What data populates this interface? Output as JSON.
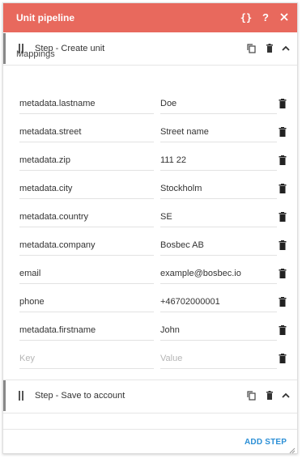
{
  "header": {
    "title": "Unit pipeline",
    "icons": [
      "code-icon",
      "help-icon",
      "close-icon"
    ],
    "color": "#e8695d"
  },
  "steps": [
    {
      "title": "Step - Create unit",
      "mappings_label": "Mappings",
      "mappings": [
        {
          "key": "metadata.lastname",
          "value": "Doe"
        },
        {
          "key": "metadata.street",
          "value": "Street name"
        },
        {
          "key": "metadata.zip",
          "value": "111 22"
        },
        {
          "key": "metadata.city",
          "value": "Stockholm"
        },
        {
          "key": "metadata.country",
          "value": "SE"
        },
        {
          "key": "metadata.company",
          "value": "Bosbec AB"
        },
        {
          "key": "email",
          "value": "example@bosbec.io"
        },
        {
          "key": "phone",
          "value": "+46702000001"
        },
        {
          "key": "metadata.firstname",
          "value": "John"
        }
      ],
      "new_mapping": {
        "key_placeholder": "Key",
        "value_placeholder": "Value"
      }
    },
    {
      "title": "Step - Save to account"
    }
  ],
  "footer": {
    "add_step_label": "ADD STEP",
    "accent": "#2b8fd6"
  }
}
